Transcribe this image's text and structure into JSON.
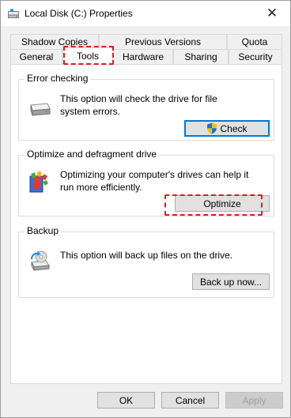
{
  "window": {
    "title": "Local Disk (C:) Properties",
    "close_glyph": "✕"
  },
  "tabs": {
    "row1": [
      "Shadow Copies",
      "Previous Versions",
      "Quota"
    ],
    "row2": [
      "General",
      "Tools",
      "Hardware",
      "Sharing",
      "Security"
    ],
    "active": "Tools"
  },
  "error_checking": {
    "title": "Error checking",
    "description": "This option will check the drive for file system errors.",
    "button_label": "Check",
    "icon": "drive-icon"
  },
  "optimize": {
    "title": "Optimize and defragment drive",
    "description": "Optimizing your computer's drives can help it run more efficiently.",
    "button_label": "Optimize",
    "icon": "defrag-icon"
  },
  "backup": {
    "title": "Backup",
    "description": "This option will back up files on the drive.",
    "button_label": "Back up now...",
    "icon": "backup-icon"
  },
  "footer": {
    "ok_label": "OK",
    "cancel_label": "Cancel",
    "apply_label": "Apply"
  },
  "colors": {
    "highlight": "#e01b1b",
    "accent": "#0078d7",
    "window_bg": "#f0f0f0"
  }
}
